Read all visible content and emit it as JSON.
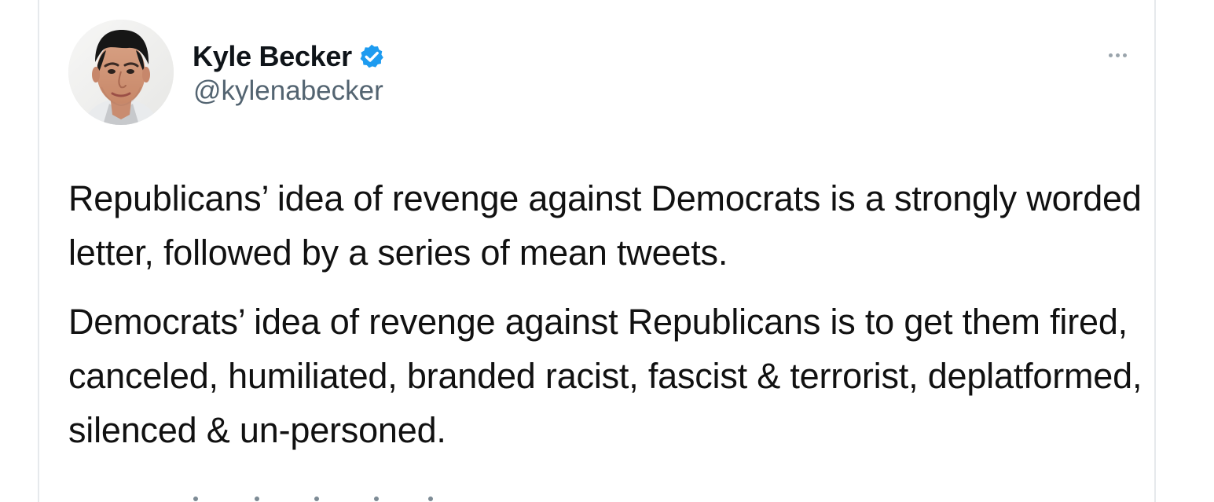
{
  "tweet": {
    "author": {
      "display_name": "Kyle Becker",
      "handle": "@kylenabecker",
      "verified": true,
      "verified_color": "#1d9bf0"
    },
    "menu_icon": "more-horizontal-icon",
    "paragraphs": [
      "Republicans’ idea of revenge against Democrats is a strongly worded letter, followed by a series of mean tweets.",
      "Democrats’ idea of revenge against Republicans is to get them fired, canceled, humiliated, branded racist, fascist & terrorist, deplatformed, silenced & un-personed."
    ]
  }
}
